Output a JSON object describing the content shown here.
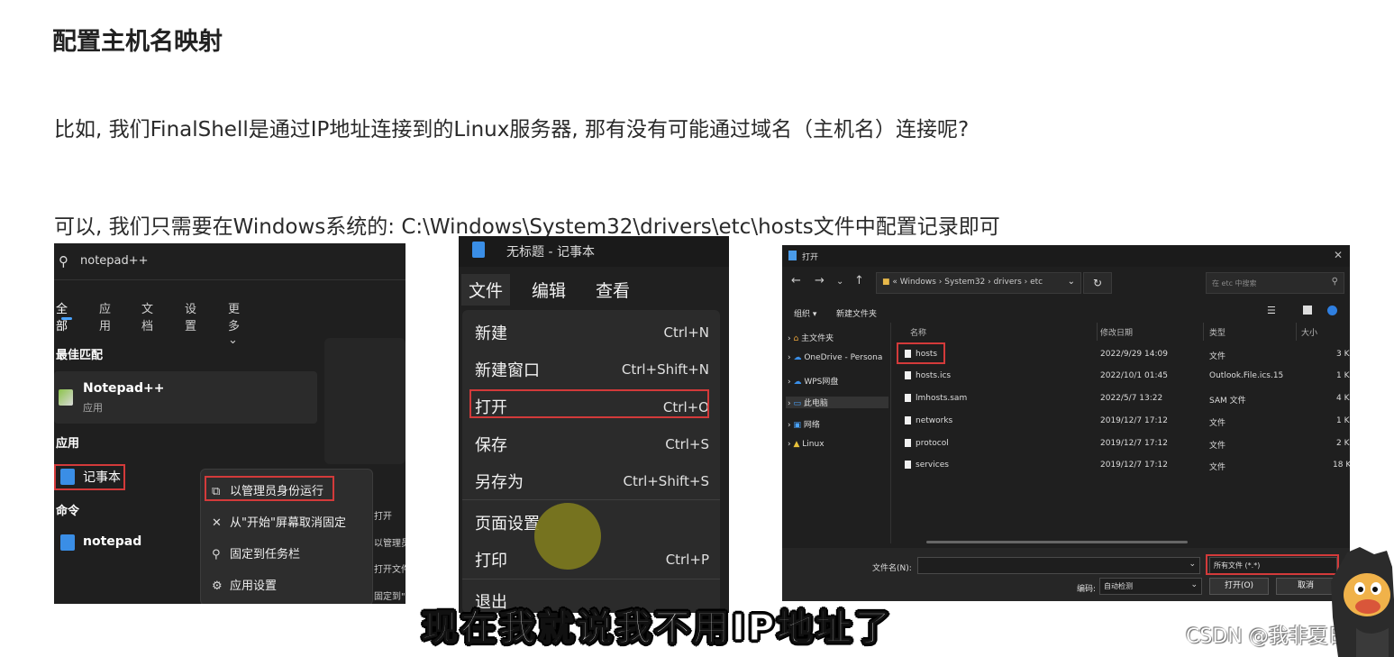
{
  "heading": "配置主机名映射",
  "para1": "比如, 我们FinalShell是通过IP地址连接到的Linux服务器, 那有没有可能通过域名（主机名）连接呢?",
  "para2": "可以, 我们只需要在Windows系统的: C:\\Windows\\System32\\drivers\\etc\\hosts文件中配置记录即可",
  "start_menu": {
    "search_text": "notepad++",
    "tabs": [
      "全部",
      "应用",
      "文档",
      "设置",
      "更多"
    ],
    "section_best": "最佳匹配",
    "best_name": "Notepad++",
    "best_sub": "应用",
    "section_apps": "应用",
    "app_notepad": "记事本",
    "section_cmd": "命令",
    "cmd_notepad": "notepad",
    "context": [
      "以管理员身份运行",
      "从\"开始\"屏幕取消固定",
      "固定到任务栏",
      "应用设置"
    ],
    "right_strip": [
      "打开",
      "以管理员",
      "打开文件",
      "固定到\""
    ]
  },
  "notepad": {
    "title": "无标题 - 记事本",
    "menus": [
      "文件",
      "编辑",
      "查看"
    ],
    "items": [
      {
        "label": "新建",
        "shortcut": "Ctrl+N"
      },
      {
        "label": "新建窗口",
        "shortcut": "Ctrl+Shift+N"
      },
      {
        "label": "打开",
        "shortcut": "Ctrl+O"
      },
      {
        "label": "保存",
        "shortcut": "Ctrl+S"
      },
      {
        "label": "另存为",
        "shortcut": "Ctrl+Shift+S"
      },
      {
        "label": "页面设置",
        "shortcut": ""
      },
      {
        "label": "打印",
        "shortcut": "Ctrl+P"
      },
      {
        "label": "退出",
        "shortcut": ""
      }
    ]
  },
  "open_dialog": {
    "title": "打开",
    "path": "« Windows › System32 › drivers › etc",
    "search_placeholder": "在 etc 中搜索",
    "organize": "组织 ▾",
    "new_folder": "新建文件夹",
    "sidebar": [
      "主文件夹",
      "OneDrive - Persona",
      "WPS网盘",
      "此电脑",
      "网络",
      "Linux"
    ],
    "columns": [
      "名称",
      "修改日期",
      "类型",
      "大小"
    ],
    "files": [
      {
        "name": "hosts",
        "date": "2022/9/29 14:09",
        "type": "文件",
        "size": "3 K"
      },
      {
        "name": "hosts.ics",
        "date": "2022/10/1 01:45",
        "type": "Outlook.File.ics.15",
        "size": "1 K"
      },
      {
        "name": "lmhosts.sam",
        "date": "2022/5/7 13:22",
        "type": "SAM 文件",
        "size": "4 K"
      },
      {
        "name": "networks",
        "date": "2019/12/7 17:12",
        "type": "文件",
        "size": "1 K"
      },
      {
        "name": "protocol",
        "date": "2019/12/7 17:12",
        "type": "文件",
        "size": "2 K"
      },
      {
        "name": "services",
        "date": "2019/12/7 17:12",
        "type": "文件",
        "size": "18 K"
      }
    ],
    "filename_label": "文件名(N):",
    "filter_value": "所有文件 (*.*)",
    "encoding_label": "编码:",
    "encoding_value": "自动检测",
    "open_button": "打开(O)",
    "cancel_button": "取消"
  },
  "subtitle": "现在我就说我不用IP地址了",
  "watermark": "CSDN @我非夏日",
  "colors": {
    "highlight_red": "#d33a3a",
    "accent_blue": "#4aa3ff",
    "subtitle_fill": "#ffffff"
  }
}
